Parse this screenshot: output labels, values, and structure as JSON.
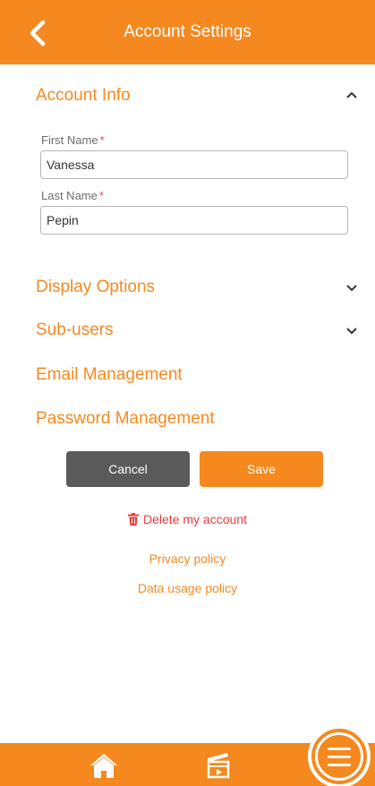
{
  "header": {
    "title": "Account Settings"
  },
  "sections": {
    "account_info": "Account Info",
    "display_options": "Display Options",
    "sub_users": "Sub-users",
    "email_management": "Email Management",
    "password_management": "Password Management"
  },
  "form": {
    "first_name_label": "First Name",
    "first_name_value": "Vanessa",
    "last_name_label": "Last Name",
    "last_name_value": "Pepin",
    "required_marker": "*"
  },
  "actions": {
    "cancel": "Cancel",
    "save": "Save"
  },
  "links": {
    "delete_account": "Delete my account",
    "privacy_policy": "Privacy policy",
    "data_usage_policy": "Data usage policy"
  },
  "colors": {
    "accent": "#f5891f",
    "danger": "#ea3a3a",
    "cancel": "#5a5a5a"
  },
  "icons": {
    "back": "chevron-left-icon",
    "expanded": "chevron-up-icon",
    "collapsed": "chevron-down-icon",
    "delete": "trash-icon",
    "home": "home-icon",
    "media": "clapperboard-icon",
    "menu": "hamburger-menu-icon"
  }
}
